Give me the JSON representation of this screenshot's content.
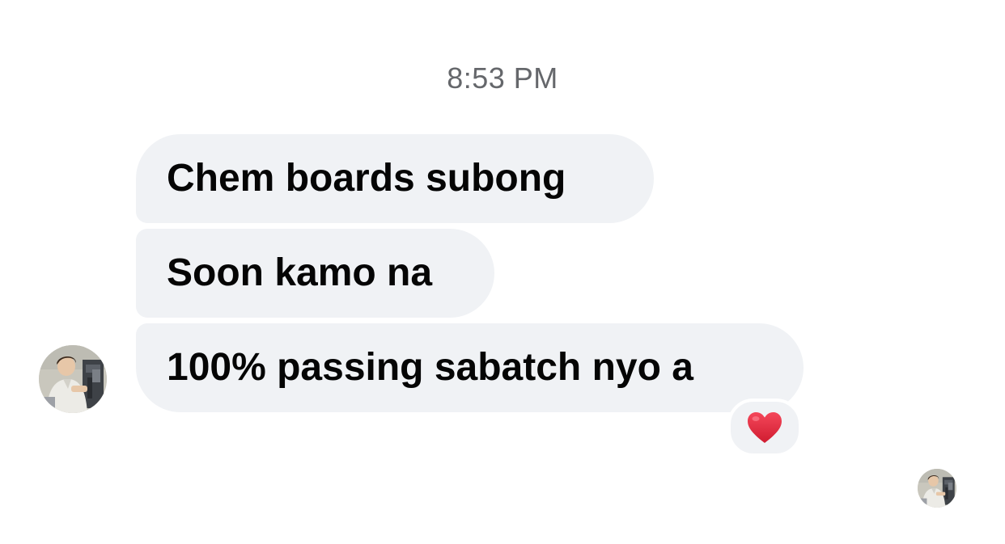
{
  "conversation": {
    "timestamp": "8:53 PM",
    "messages": [
      {
        "text": "Chem boards subong"
      },
      {
        "text": "Soon kamo na"
      },
      {
        "text": "100% passing sabatch nyo a"
      }
    ],
    "reaction": {
      "icon": "red-heart-icon",
      "color": "#e0243a"
    },
    "sender_avatar": {
      "icon": "person-at-microscope"
    },
    "seen_avatar": {
      "icon": "person-at-microscope"
    }
  },
  "colors": {
    "bubble_background": "#f0f2f5",
    "message_text": "#050505",
    "timestamp_text": "#65676b",
    "background": "#ffffff"
  }
}
